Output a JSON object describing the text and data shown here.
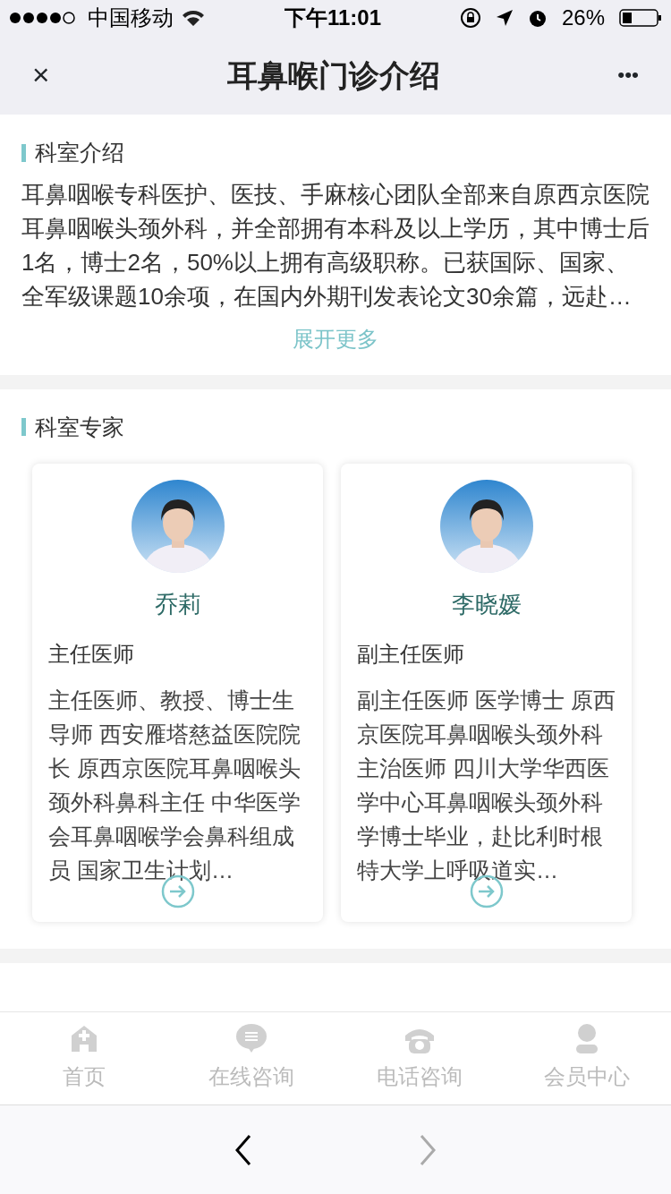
{
  "status_bar": {
    "carrier": "中国移动",
    "time": "下午11:01",
    "battery": "26%"
  },
  "nav": {
    "close": "×",
    "title": "耳鼻喉门诊介绍",
    "more": "•••"
  },
  "intro": {
    "heading": "科室介绍",
    "text": "耳鼻咽喉专科医护、医技、手麻核心团队全部来自原西京医院耳鼻咽喉头颈外科，并全部拥有本科及以上学历，其中博士后1名，博士2名，50%以上拥有高级职称。已获国际、国家、全军级课题10余项，在国内外期刊发表论文30余篇，远赴…",
    "more": "展开更多"
  },
  "experts": {
    "heading": "科室专家",
    "items": [
      {
        "name": "乔莉",
        "title": "主任医师",
        "bio": "主任医师、教授、博士生导师 西安雁塔慈益医院院长 原西京医院耳鼻咽喉头颈外科鼻科主任 中华医学会耳鼻咽喉学会鼻科组成员 国家卫生计划…"
      },
      {
        "name": "李晓媛",
        "title": "副主任医师",
        "bio": "副主任医师 医学博士 原西京医院耳鼻咽喉头颈外科主治医师 四川大学华西医学中心耳鼻咽喉头颈外科学博士毕业，赴比利时根特大学上呼吸道实…"
      }
    ]
  },
  "tab_bar": [
    {
      "label": "首页",
      "kind": "home"
    },
    {
      "label": "在线咨询",
      "kind": "chat"
    },
    {
      "label": "电话咨询",
      "kind": "phone"
    },
    {
      "label": "会员中心",
      "kind": "user"
    }
  ],
  "browser_bar": {
    "back": {
      "disabled": false
    },
    "forward": {
      "disabled": true
    }
  }
}
